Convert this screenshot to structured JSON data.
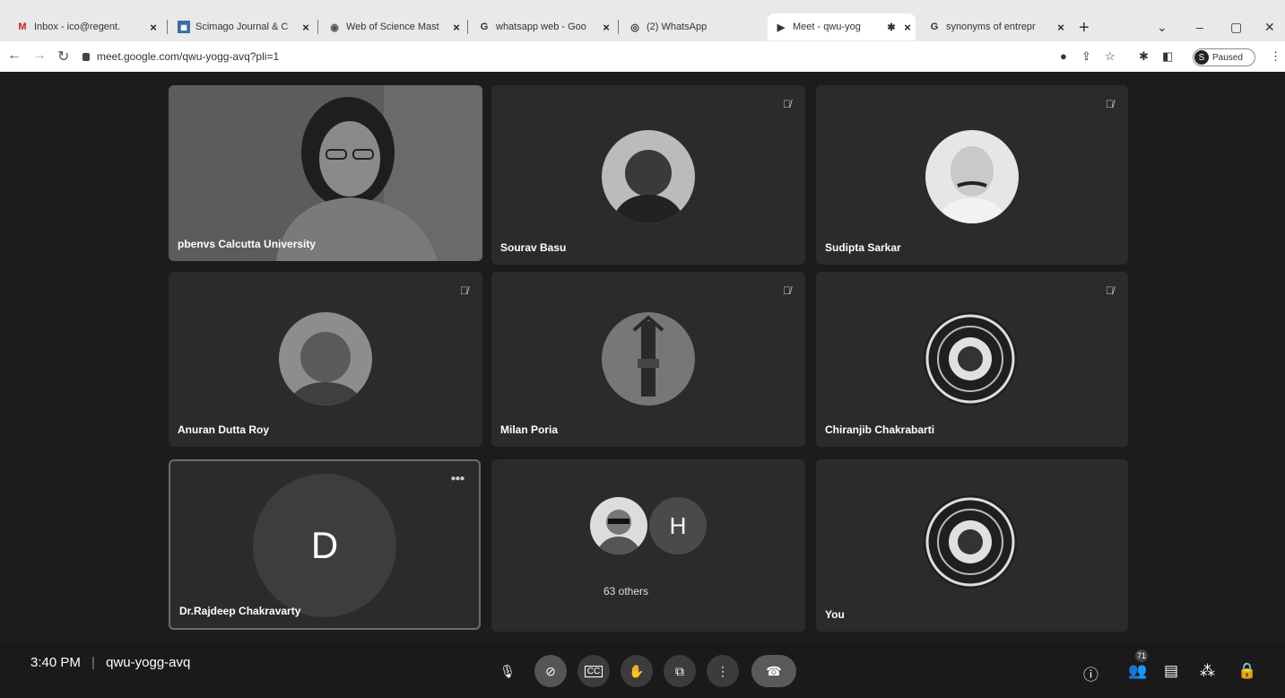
{
  "browser": {
    "tabs": [
      {
        "label": "Inbox - ico@regent.",
        "icon": "gmail-icon"
      },
      {
        "label": "Scimago Journal & C",
        "icon": "scimago-icon"
      },
      {
        "label": "Web of Science Mast",
        "icon": "wos-icon"
      },
      {
        "label": "whatsapp web - Goo",
        "icon": "google-icon"
      },
      {
        "label": "(2) WhatsApp",
        "icon": "whatsapp-icon"
      },
      {
        "label": "Meet - qwu-yog",
        "icon": "meet-icon"
      },
      {
        "label": "synonyms of entrepr",
        "icon": "google-icon"
      }
    ],
    "active_tab": 5,
    "url": "meet.google.com/qwu-yogg-avq?pli=1",
    "profile_label": "Paused",
    "profile_initial": "S"
  },
  "meeting": {
    "participants": [
      {
        "name": "pbenvs Calcutta University"
      },
      {
        "name": "Sourav Basu"
      },
      {
        "name": "Sudipta Sarkar"
      },
      {
        "name": "Anuran Dutta Roy"
      },
      {
        "name": "Milan Poria"
      },
      {
        "name": "Chiranjib Chakrabarti"
      },
      {
        "name": "Dr.Rajdeep Chakravarty",
        "initial": "D"
      },
      {
        "name": "63 others",
        "initial": "H"
      },
      {
        "name": "You"
      }
    ],
    "time": "3:40 PM",
    "code": "qwu-yogg-avq",
    "separator": "|",
    "participant_count": "71"
  }
}
